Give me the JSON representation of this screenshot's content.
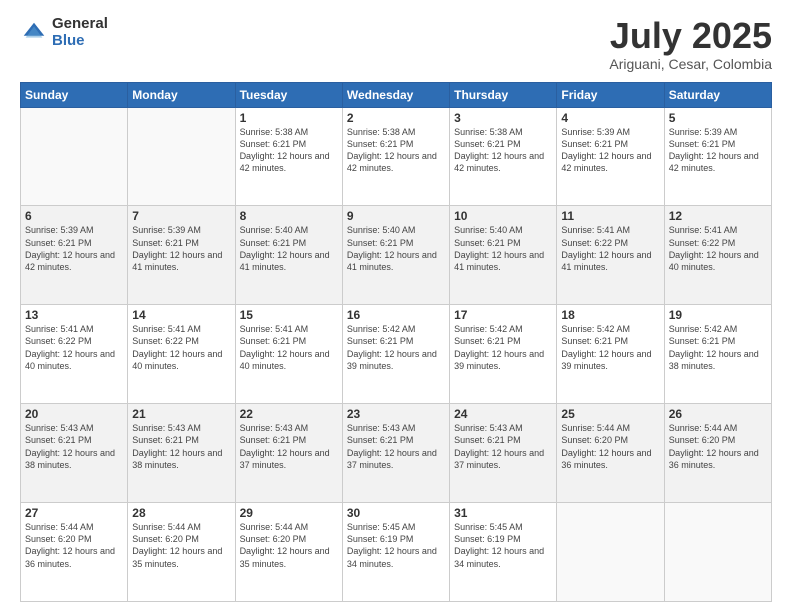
{
  "logo": {
    "general": "General",
    "blue": "Blue"
  },
  "title": "July 2025",
  "location": "Ariguani, Cesar, Colombia",
  "weekdays": [
    "Sunday",
    "Monday",
    "Tuesday",
    "Wednesday",
    "Thursday",
    "Friday",
    "Saturday"
  ],
  "weeks": [
    [
      {
        "day": "",
        "sunrise": "",
        "sunset": "",
        "daylight": ""
      },
      {
        "day": "",
        "sunrise": "",
        "sunset": "",
        "daylight": ""
      },
      {
        "day": "1",
        "sunrise": "Sunrise: 5:38 AM",
        "sunset": "Sunset: 6:21 PM",
        "daylight": "Daylight: 12 hours and 42 minutes."
      },
      {
        "day": "2",
        "sunrise": "Sunrise: 5:38 AM",
        "sunset": "Sunset: 6:21 PM",
        "daylight": "Daylight: 12 hours and 42 minutes."
      },
      {
        "day": "3",
        "sunrise": "Sunrise: 5:38 AM",
        "sunset": "Sunset: 6:21 PM",
        "daylight": "Daylight: 12 hours and 42 minutes."
      },
      {
        "day": "4",
        "sunrise": "Sunrise: 5:39 AM",
        "sunset": "Sunset: 6:21 PM",
        "daylight": "Daylight: 12 hours and 42 minutes."
      },
      {
        "day": "5",
        "sunrise": "Sunrise: 5:39 AM",
        "sunset": "Sunset: 6:21 PM",
        "daylight": "Daylight: 12 hours and 42 minutes."
      }
    ],
    [
      {
        "day": "6",
        "sunrise": "Sunrise: 5:39 AM",
        "sunset": "Sunset: 6:21 PM",
        "daylight": "Daylight: 12 hours and 42 minutes."
      },
      {
        "day": "7",
        "sunrise": "Sunrise: 5:39 AM",
        "sunset": "Sunset: 6:21 PM",
        "daylight": "Daylight: 12 hours and 41 minutes."
      },
      {
        "day": "8",
        "sunrise": "Sunrise: 5:40 AM",
        "sunset": "Sunset: 6:21 PM",
        "daylight": "Daylight: 12 hours and 41 minutes."
      },
      {
        "day": "9",
        "sunrise": "Sunrise: 5:40 AM",
        "sunset": "Sunset: 6:21 PM",
        "daylight": "Daylight: 12 hours and 41 minutes."
      },
      {
        "day": "10",
        "sunrise": "Sunrise: 5:40 AM",
        "sunset": "Sunset: 6:21 PM",
        "daylight": "Daylight: 12 hours and 41 minutes."
      },
      {
        "day": "11",
        "sunrise": "Sunrise: 5:41 AM",
        "sunset": "Sunset: 6:22 PM",
        "daylight": "Daylight: 12 hours and 41 minutes."
      },
      {
        "day": "12",
        "sunrise": "Sunrise: 5:41 AM",
        "sunset": "Sunset: 6:22 PM",
        "daylight": "Daylight: 12 hours and 40 minutes."
      }
    ],
    [
      {
        "day": "13",
        "sunrise": "Sunrise: 5:41 AM",
        "sunset": "Sunset: 6:22 PM",
        "daylight": "Daylight: 12 hours and 40 minutes."
      },
      {
        "day": "14",
        "sunrise": "Sunrise: 5:41 AM",
        "sunset": "Sunset: 6:22 PM",
        "daylight": "Daylight: 12 hours and 40 minutes."
      },
      {
        "day": "15",
        "sunrise": "Sunrise: 5:41 AM",
        "sunset": "Sunset: 6:21 PM",
        "daylight": "Daylight: 12 hours and 40 minutes."
      },
      {
        "day": "16",
        "sunrise": "Sunrise: 5:42 AM",
        "sunset": "Sunset: 6:21 PM",
        "daylight": "Daylight: 12 hours and 39 minutes."
      },
      {
        "day": "17",
        "sunrise": "Sunrise: 5:42 AM",
        "sunset": "Sunset: 6:21 PM",
        "daylight": "Daylight: 12 hours and 39 minutes."
      },
      {
        "day": "18",
        "sunrise": "Sunrise: 5:42 AM",
        "sunset": "Sunset: 6:21 PM",
        "daylight": "Daylight: 12 hours and 39 minutes."
      },
      {
        "day": "19",
        "sunrise": "Sunrise: 5:42 AM",
        "sunset": "Sunset: 6:21 PM",
        "daylight": "Daylight: 12 hours and 38 minutes."
      }
    ],
    [
      {
        "day": "20",
        "sunrise": "Sunrise: 5:43 AM",
        "sunset": "Sunset: 6:21 PM",
        "daylight": "Daylight: 12 hours and 38 minutes."
      },
      {
        "day": "21",
        "sunrise": "Sunrise: 5:43 AM",
        "sunset": "Sunset: 6:21 PM",
        "daylight": "Daylight: 12 hours and 38 minutes."
      },
      {
        "day": "22",
        "sunrise": "Sunrise: 5:43 AM",
        "sunset": "Sunset: 6:21 PM",
        "daylight": "Daylight: 12 hours and 37 minutes."
      },
      {
        "day": "23",
        "sunrise": "Sunrise: 5:43 AM",
        "sunset": "Sunset: 6:21 PM",
        "daylight": "Daylight: 12 hours and 37 minutes."
      },
      {
        "day": "24",
        "sunrise": "Sunrise: 5:43 AM",
        "sunset": "Sunset: 6:21 PM",
        "daylight": "Daylight: 12 hours and 37 minutes."
      },
      {
        "day": "25",
        "sunrise": "Sunrise: 5:44 AM",
        "sunset": "Sunset: 6:20 PM",
        "daylight": "Daylight: 12 hours and 36 minutes."
      },
      {
        "day": "26",
        "sunrise": "Sunrise: 5:44 AM",
        "sunset": "Sunset: 6:20 PM",
        "daylight": "Daylight: 12 hours and 36 minutes."
      }
    ],
    [
      {
        "day": "27",
        "sunrise": "Sunrise: 5:44 AM",
        "sunset": "Sunset: 6:20 PM",
        "daylight": "Daylight: 12 hours and 36 minutes."
      },
      {
        "day": "28",
        "sunrise": "Sunrise: 5:44 AM",
        "sunset": "Sunset: 6:20 PM",
        "daylight": "Daylight: 12 hours and 35 minutes."
      },
      {
        "day": "29",
        "sunrise": "Sunrise: 5:44 AM",
        "sunset": "Sunset: 6:20 PM",
        "daylight": "Daylight: 12 hours and 35 minutes."
      },
      {
        "day": "30",
        "sunrise": "Sunrise: 5:45 AM",
        "sunset": "Sunset: 6:19 PM",
        "daylight": "Daylight: 12 hours and 34 minutes."
      },
      {
        "day": "31",
        "sunrise": "Sunrise: 5:45 AM",
        "sunset": "Sunset: 6:19 PM",
        "daylight": "Daylight: 12 hours and 34 minutes."
      },
      {
        "day": "",
        "sunrise": "",
        "sunset": "",
        "daylight": ""
      },
      {
        "day": "",
        "sunrise": "",
        "sunset": "",
        "daylight": ""
      }
    ]
  ]
}
